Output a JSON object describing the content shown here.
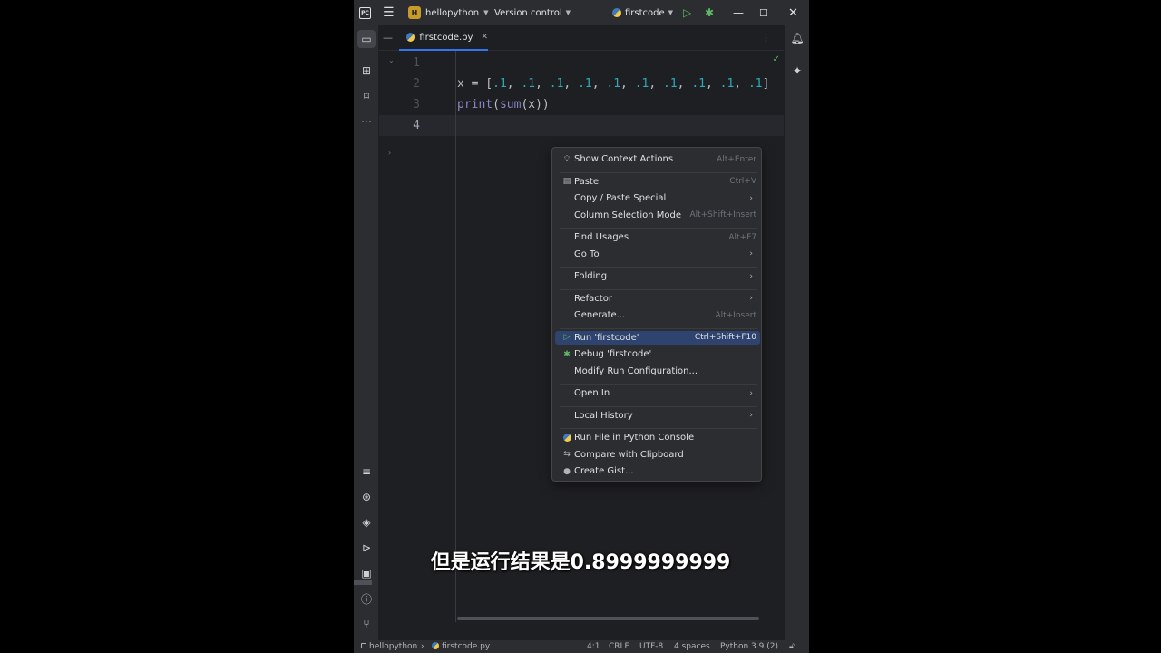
{
  "titlebar": {
    "app_icon": "pycharm-icon",
    "menu_icon": "hamburger-icon",
    "project_badge": "H",
    "project_name": "hellopython",
    "vcs_label": "Version control",
    "run_config": "firstcode"
  },
  "tabs": [
    {
      "label": "firstcode.py",
      "active": true
    }
  ],
  "editor": {
    "line_numbers": [
      "1",
      "2",
      "3",
      "4"
    ],
    "current_line": 4,
    "lines": [
      {
        "text": ""
      },
      {
        "parts": [
          {
            "t": "x = [",
            "c": "plain"
          },
          {
            "t": ".1",
            "c": "num"
          },
          {
            "t": ", ",
            "c": "plain"
          },
          {
            "t": ".1",
            "c": "num"
          },
          {
            "t": ", ",
            "c": "plain"
          },
          {
            "t": ".1",
            "c": "num"
          },
          {
            "t": ", ",
            "c": "plain"
          },
          {
            "t": ".1",
            "c": "num"
          },
          {
            "t": ", ",
            "c": "plain"
          },
          {
            "t": ".1",
            "c": "num"
          },
          {
            "t": ", ",
            "c": "plain"
          },
          {
            "t": ".1",
            "c": "num"
          },
          {
            "t": ", ",
            "c": "plain"
          },
          {
            "t": ".1",
            "c": "num"
          },
          {
            "t": ", ",
            "c": "plain"
          },
          {
            "t": ".1",
            "c": "num"
          },
          {
            "t": ", ",
            "c": "plain"
          },
          {
            "t": ".1",
            "c": "num"
          },
          {
            "t": ", ",
            "c": "plain"
          },
          {
            "t": ".1",
            "c": "num"
          },
          {
            "t": "]",
            "c": "plain"
          }
        ]
      },
      {
        "parts": [
          {
            "t": "print",
            "c": "fn"
          },
          {
            "t": "(",
            "c": "plain"
          },
          {
            "t": "sum",
            "c": "fn"
          },
          {
            "t": "(x))",
            "c": "plain"
          }
        ]
      },
      {
        "text": ""
      }
    ]
  },
  "context_menu": {
    "items": [
      {
        "label": "Show Context Actions",
        "shortcut": "Alt+Enter",
        "icon": "lightbulb-icon"
      },
      {
        "sep": true
      },
      {
        "label": "Paste",
        "shortcut": "Ctrl+V",
        "icon": "clipboard-icon"
      },
      {
        "label": "Copy / Paste Special",
        "submenu": true
      },
      {
        "label": "Column Selection Mode",
        "shortcut": "Alt+Shift+Insert"
      },
      {
        "sep": true
      },
      {
        "label": "Find Usages",
        "shortcut": "Alt+F7"
      },
      {
        "label": "Go To",
        "submenu": true
      },
      {
        "sep": true
      },
      {
        "label": "Folding",
        "submenu": true
      },
      {
        "sep": true
      },
      {
        "label": "Refactor",
        "submenu": true
      },
      {
        "label": "Generate...",
        "shortcut": "Alt+Insert"
      },
      {
        "sep": true
      },
      {
        "label": "Run 'firstcode'",
        "shortcut": "Ctrl+Shift+F10",
        "icon": "run-icon",
        "highlighted": true
      },
      {
        "label": "Debug 'firstcode'",
        "icon": "debug-icon"
      },
      {
        "label": "Modify Run Configuration..."
      },
      {
        "sep": true
      },
      {
        "label": "Open In",
        "submenu": true
      },
      {
        "sep": true
      },
      {
        "label": "Local History",
        "submenu": true
      },
      {
        "sep": true
      },
      {
        "label": "Run File in Python Console",
        "icon": "python-icon"
      },
      {
        "label": "Compare with Clipboard",
        "icon": "compare-icon"
      },
      {
        "label": "Create Gist...",
        "icon": "github-icon"
      }
    ]
  },
  "statusbar": {
    "project": "hellopython",
    "file": "firstcode.py",
    "position": "4:1",
    "line_sep": "CRLF",
    "encoding": "UTF-8",
    "indent": "4 spaces",
    "interpreter": "Python 3.9 (2)"
  },
  "subtitle": "但是运行结果是0.8999999999",
  "colors": {
    "accent": "#3574f0",
    "highlight": "#2e436e",
    "run_green": "#5fb865",
    "number": "#2aacb8",
    "builtin": "#8888c6"
  }
}
